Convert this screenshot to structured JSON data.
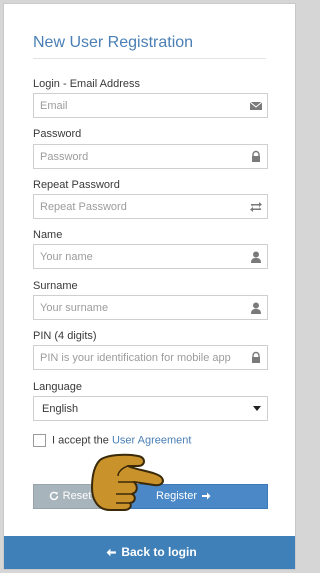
{
  "form": {
    "title": "New User Registration",
    "email": {
      "label": "Login - Email Address",
      "placeholder": "Email",
      "value": "",
      "icon": "envelope-icon"
    },
    "password": {
      "label": "Password",
      "placeholder": "Password",
      "value": "",
      "icon": "lock-icon"
    },
    "repeat_password": {
      "label": "Repeat Password",
      "placeholder": "Repeat Password",
      "value": "",
      "icon": "retweet-icon"
    },
    "name": {
      "label": "Name",
      "placeholder": "Your name",
      "value": "",
      "icon": "user-icon"
    },
    "surname": {
      "label": "Surname",
      "placeholder": "Your surname",
      "value": "",
      "icon": "user-icon"
    },
    "pin": {
      "label": "PIN (4 digits)",
      "placeholder": "PIN is your identification for mobile app",
      "value": "",
      "icon": "lock-icon"
    },
    "language": {
      "label": "Language",
      "selected": "English"
    },
    "agreement": {
      "prefix": "I accept the",
      "link": "User Agreement",
      "checked": false
    }
  },
  "buttons": {
    "reset": {
      "label": "Reset",
      "icon": "refresh-icon"
    },
    "register": {
      "label": "Register",
      "icon": "arrow-right-icon"
    }
  },
  "footer": {
    "back_label": "Back to login",
    "icon": "arrow-left-icon"
  },
  "colors": {
    "accent": "#4a7fb5",
    "register_bg": "#4a88c8",
    "reset_bg": "#a8b4bc",
    "footer_bg": "#3f80b8",
    "pointer_hand": "#c9922b"
  },
  "overlay": {
    "icon": "pointing-hand-icon"
  }
}
